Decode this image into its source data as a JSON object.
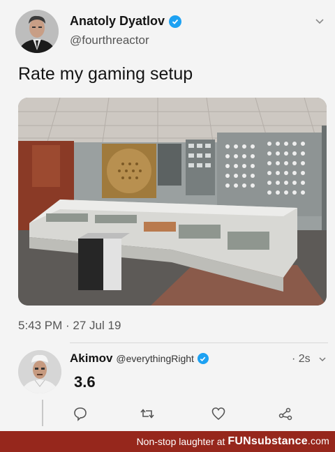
{
  "tweet": {
    "author_name": "Anatoly Dyatlov",
    "author_handle": "@fourthreactor",
    "text": "Rate my gaming setup",
    "timestamp": "5:43 PM · 27 Jul 19"
  },
  "reply": {
    "author_name": "Akimov",
    "author_handle": "@everythingRight",
    "time": "· 2s",
    "text": "3.6"
  },
  "footer": {
    "text": "Non-stop laughter at",
    "brand": "FUNsubstance",
    "domain": ".com"
  },
  "colors": {
    "verified": "#1da1f2",
    "footer_bg": "#96271c"
  }
}
